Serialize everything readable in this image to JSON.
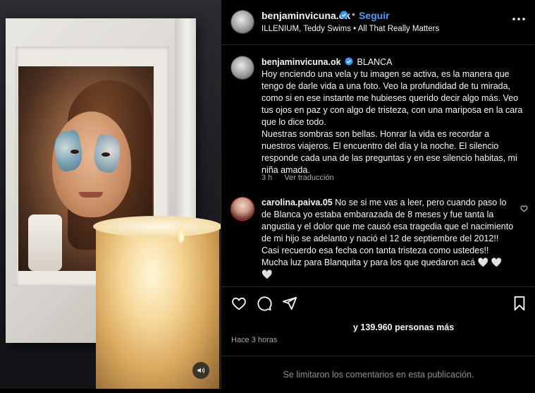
{
  "post": {
    "username": "benjaminvicuna.ok",
    "follow_label": "Seguir",
    "separator": "•",
    "music": "ILLENIUM, Teddy Swims • All That Really Matters"
  },
  "caption": {
    "username": "benjaminvicuna.ok",
    "text": "BLANCA\nHoy enciendo una vela y tu imagen se activa, es la manera que tengo de darle vida a una foto. Veo la profundidad de tu mirada, como si en ese instante me hubieses querido decir algo más. Veo tus ojos en paz y con algo de tristeza, con una mariposa en la cara que lo dice todo.\nNuestras sombras son bellas. Honrar la vida es recordar a nuestros viajeros. El encuentro del día y la noche. El silencio responde cada una de las preguntas y en ese silencio habitas, mi niña amada.",
    "time": "3 h",
    "translate_label": "Ver traducción"
  },
  "comment": {
    "username": "carolina.paiva.05",
    "text": "No se si me vas a leer, pero cuando paso lo de Blanca yo estaba embarazada de 8 meses y fue tanta la angustia y el dolor que me causó esa tragedia que el nacimiento de mi hijo se adelanto y nació el 12 de septiembre del 2012!! Casi recuerdo esa fecha con tanta tristeza como ustedes!! Mucha luz para Blanquita y para los que quedaron acá 🤍 🤍 🤍"
  },
  "likes_text": "y 139.960 personas más",
  "posted_time": "Hace 3 horas",
  "comments_disabled": "Se limitaron los comentarios en esta publicación.",
  "icons": {
    "like": "heart-icon",
    "comment": "comment-icon",
    "share": "share-icon",
    "save": "bookmark-icon",
    "more": "more-options-icon",
    "verified": "verified-badge-icon",
    "sound": "volume-icon"
  },
  "colors": {
    "accent": "#4a9df8",
    "verified": "#3897f0",
    "bg": "#000000",
    "muted": "#a8a8a8"
  }
}
